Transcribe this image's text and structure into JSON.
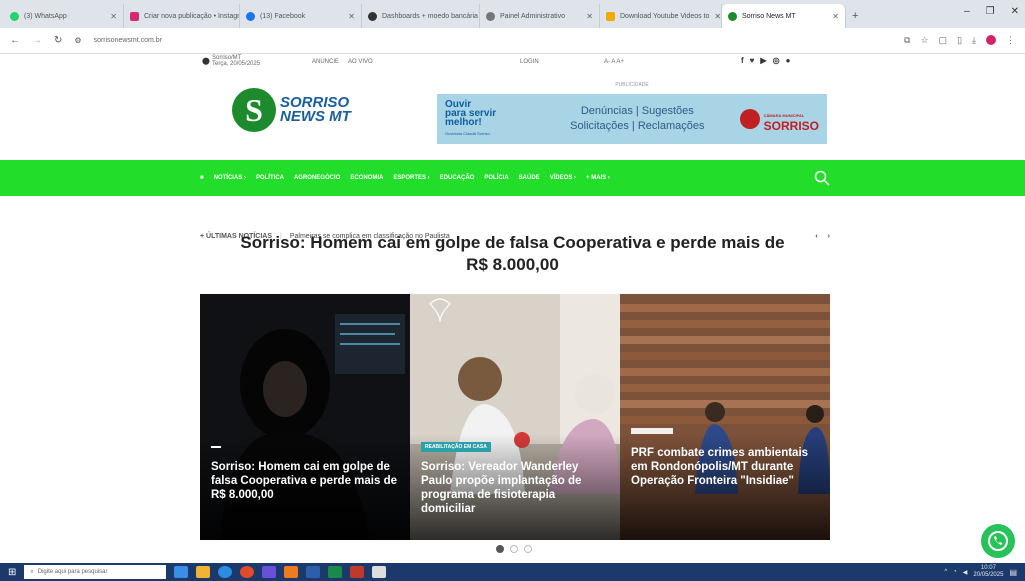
{
  "browser": {
    "tabs": [
      {
        "label": "(3) WhatsApp",
        "color": "#25d366"
      },
      {
        "label": "Criar nova publicação • Instagr",
        "color": "#d62976"
      },
      {
        "label": "(13) Facebook",
        "color": "#1877f2"
      },
      {
        "label": "Dashboards + moedo bancária",
        "color": "#333333"
      },
      {
        "label": "Painel Administrativo",
        "color": "#777777"
      },
      {
        "label": "Download Youtube Videos to",
        "color": "#f2a900"
      },
      {
        "label": "Sorriso News MT",
        "color": "#1e8a2e",
        "active": true
      }
    ],
    "url": "sorrisonewsmt.com.br",
    "new_tab": "+",
    "window_controls": [
      "–",
      "❐",
      "✕"
    ]
  },
  "top_strip": {
    "location": "Sorriso/MT",
    "date": "Terça, 20/05/2025",
    "anuncie": "ANUNCIE",
    "ao_vivo": "AO VIVO",
    "login": "LOGIN",
    "font_size": "A- A A+"
  },
  "site": {
    "logo_line1": "SORRISO",
    "logo_line2": "NEWS MT",
    "ad_label": "PUBLICIDADE",
    "ad": {
      "left_line1": "Ouvir",
      "left_line2": "para servir",
      "left_line3": "melhor!",
      "left_small": "Ouvidoria Cidadã Sorriso",
      "mid_line1": "Denúncias | Sugestões",
      "mid_line2": "Solicitações | Reclamações",
      "right_small": "CÂMARA MUNICIPAL",
      "right_main": "SORRISO"
    }
  },
  "nav": {
    "items": [
      "NOTÍCIAS ›",
      "POLÍTICA",
      "AGRONEGÓCIO",
      "ECONOMIA",
      "ESPORTES ›",
      "EDUCAÇÃO",
      "POLÍCIA",
      "SAÚDE",
      "VÍDEOS ›",
      "+ MAIS ›"
    ]
  },
  "ticker": {
    "label": "+ ÚLTIMAS NOTÍCIAS",
    "text": "Palmeiras se complica em classificação no Paulista",
    "prev": "‹",
    "next": "›"
  },
  "headline": "Sorriso: Homem cai em golpe de falsa Cooperativa e perde mais de R$ 8.000,00",
  "cards": [
    {
      "tag": "",
      "title": "Sorriso: Homem cai em golpe de falsa Cooperativa e perde mais de R$ 8.000,00",
      "bg": "#1a1a1a"
    },
    {
      "tag": "REABILITAÇÃO EM CASA",
      "title": "Sorriso: Vereador Wanderley Paulo propõe implantação de programa de fisioterapia domiciliar",
      "bg": "#c9c3b8"
    },
    {
      "tag": "",
      "title": "PRF combate crimes ambientais em Rondonópolis/MT durante Operação Fronteira \"Insidiae\"",
      "bg": "#8a5a3c"
    }
  ],
  "taskbar": {
    "search_placeholder": "Digite aqui para pesquisar",
    "time": "10:07",
    "date": "20/05/2025"
  }
}
